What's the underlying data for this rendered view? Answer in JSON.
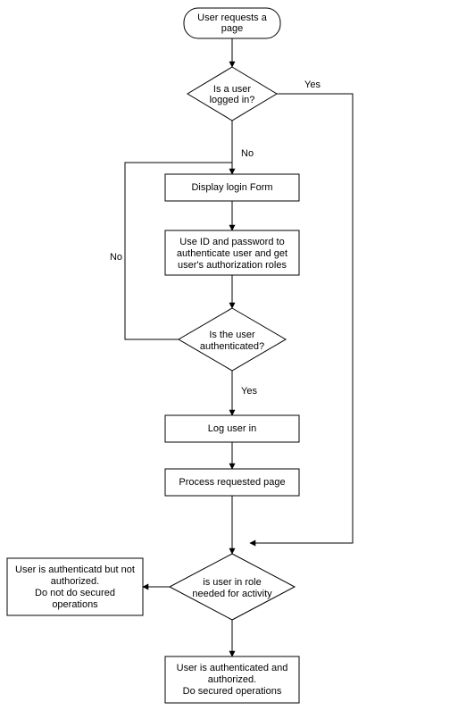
{
  "chart_data": {
    "type": "flowchart",
    "nodes": [
      {
        "id": "start",
        "kind": "terminator",
        "text": [
          "User requests a",
          "page"
        ]
      },
      {
        "id": "d_logged",
        "kind": "decision",
        "text": [
          "Is a user",
          "logged in?"
        ]
      },
      {
        "id": "p_form",
        "kind": "process",
        "text": [
          "Display login Form"
        ]
      },
      {
        "id": "p_auth",
        "kind": "process",
        "text": [
          "Use ID and password to",
          "authenticate user and get",
          "user's authorization roles"
        ]
      },
      {
        "id": "d_authok",
        "kind": "decision",
        "text": [
          "Is the user",
          "authenticated?"
        ]
      },
      {
        "id": "p_login",
        "kind": "process",
        "text": [
          "Log user in"
        ]
      },
      {
        "id": "p_process",
        "kind": "process",
        "text": [
          "Process requested page"
        ]
      },
      {
        "id": "d_role",
        "kind": "decision",
        "text": [
          "is user in role",
          "needed for activity"
        ]
      },
      {
        "id": "r_no",
        "kind": "process",
        "text": [
          "User is authenticatd but not",
          "authorized.",
          "Do not do secured",
          "operations"
        ]
      },
      {
        "id": "r_yes",
        "kind": "process",
        "text": [
          "User is authenticated and",
          "authorized.",
          "Do secured operations"
        ]
      }
    ],
    "edges": [
      {
        "from": "start",
        "to": "d_logged",
        "label": ""
      },
      {
        "from": "d_logged",
        "to": "p_form",
        "label": "No"
      },
      {
        "from": "d_logged",
        "to": "d_role",
        "label": "Yes"
      },
      {
        "from": "p_form",
        "to": "p_auth",
        "label": ""
      },
      {
        "from": "p_auth",
        "to": "d_authok",
        "label": ""
      },
      {
        "from": "d_authok",
        "to": "p_login",
        "label": "Yes"
      },
      {
        "from": "d_authok",
        "to": "p_form",
        "label": "No"
      },
      {
        "from": "p_login",
        "to": "p_process",
        "label": ""
      },
      {
        "from": "p_process",
        "to": "d_role",
        "label": ""
      },
      {
        "from": "d_role",
        "to": "r_no",
        "label": ""
      },
      {
        "from": "d_role",
        "to": "r_yes",
        "label": ""
      }
    ],
    "labels": {
      "yes": "Yes",
      "no": "No"
    }
  }
}
